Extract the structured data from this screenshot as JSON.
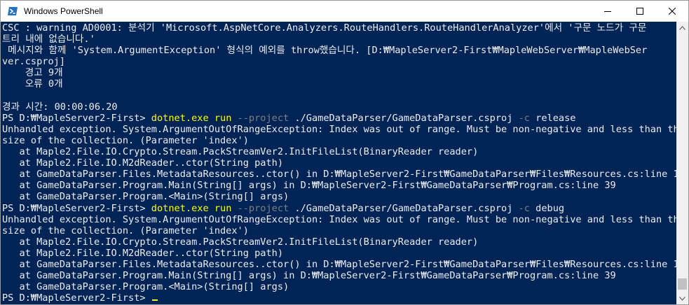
{
  "window": {
    "title": "Windows PowerShell",
    "controls": {
      "minimize": "minimize",
      "maximize": "maximize",
      "close": "close"
    }
  },
  "console": {
    "lines": [
      {
        "text": "CSC : warning AD0001: 분석기 'Microsoft.AspNetCore.Analyzers.RouteHandlers.RouteHandlerAnalyzer'에서 '구문 노드가 구문"
      },
      {
        "text": "트리 내에 없습니다.'"
      },
      {
        "text": " 메시지와 함께 'System.ArgumentException' 형식의 예외를 throw했습니다. [D:₩MapleServer2-First₩MapleWebServer₩MapleWebSer"
      },
      {
        "text": "ver.csproj]"
      },
      {
        "text": "    경고 9개"
      },
      {
        "text": "    오류 0개"
      },
      {
        "text": ""
      },
      {
        "text": "경과 시간: 00:00:06.20"
      },
      {
        "prompt": "PS D:₩MapleServer2-First> ",
        "cmd": "dotnet.exe run ",
        "flag": "--project",
        "rest": " ./GameDataParser/GameDataParser.csproj ",
        "flag2": "-c",
        "rest2": " release"
      },
      {
        "text": "Unhandled exception. System.ArgumentOutOfRangeException: Index was out of range. Must be non-negative and less than the"
      },
      {
        "text": "size of the collection. (Parameter 'index')"
      },
      {
        "text": "   at Maple2.File.IO.Crypto.Stream.PackStreamVer2.InitFileList(BinaryReader reader)"
      },
      {
        "text": "   at Maple2.File.IO.M2dReader..ctor(String path)"
      },
      {
        "text": "   at GameDataParser.Files.MetadataResources..ctor() in D:₩MapleServer2-First₩GameDataParser₩Files₩Resources.cs:line 18"
      },
      {
        "text": "   at GameDataParser.Program.Main(String[] args) in D:₩MapleServer2-First₩GameDataParser₩Program.cs:line 39"
      },
      {
        "text": "   at GameDataParser.Program.<Main>(String[] args)"
      },
      {
        "prompt": "PS D:₩MapleServer2-First> ",
        "cmd": "dotnet.exe run ",
        "flag": "--project",
        "rest": " ./GameDataParser/GameDataParser.csproj ",
        "flag2": "-c",
        "rest2": " debug"
      },
      {
        "text": "Unhandled exception. System.ArgumentOutOfRangeException: Index was out of range. Must be non-negative and less than the"
      },
      {
        "text": "size of the collection. (Parameter 'index')"
      },
      {
        "text": "   at Maple2.File.IO.Crypto.Stream.PackStreamVer2.InitFileList(BinaryReader reader)"
      },
      {
        "text": "   at Maple2.File.IO.M2dReader..ctor(String path)"
      },
      {
        "text": "   at GameDataParser.Files.MetadataResources..ctor() in D:₩MapleServer2-First₩GameDataParser₩Files₩Resources.cs:line 18"
      },
      {
        "text": "   at GameDataParser.Program.Main(String[] args) in D:₩MapleServer2-First₩GameDataParser₩Program.cs:line 39"
      },
      {
        "text": "   at GameDataParser.Program.<Main>(String[] args)"
      },
      {
        "prompt": "PS D:₩MapleServer2-First> ",
        "cursor": true
      }
    ]
  },
  "colors": {
    "background": "#012456",
    "text": "#eeedf0",
    "command": "#ffff00",
    "parameter": "#808080"
  }
}
